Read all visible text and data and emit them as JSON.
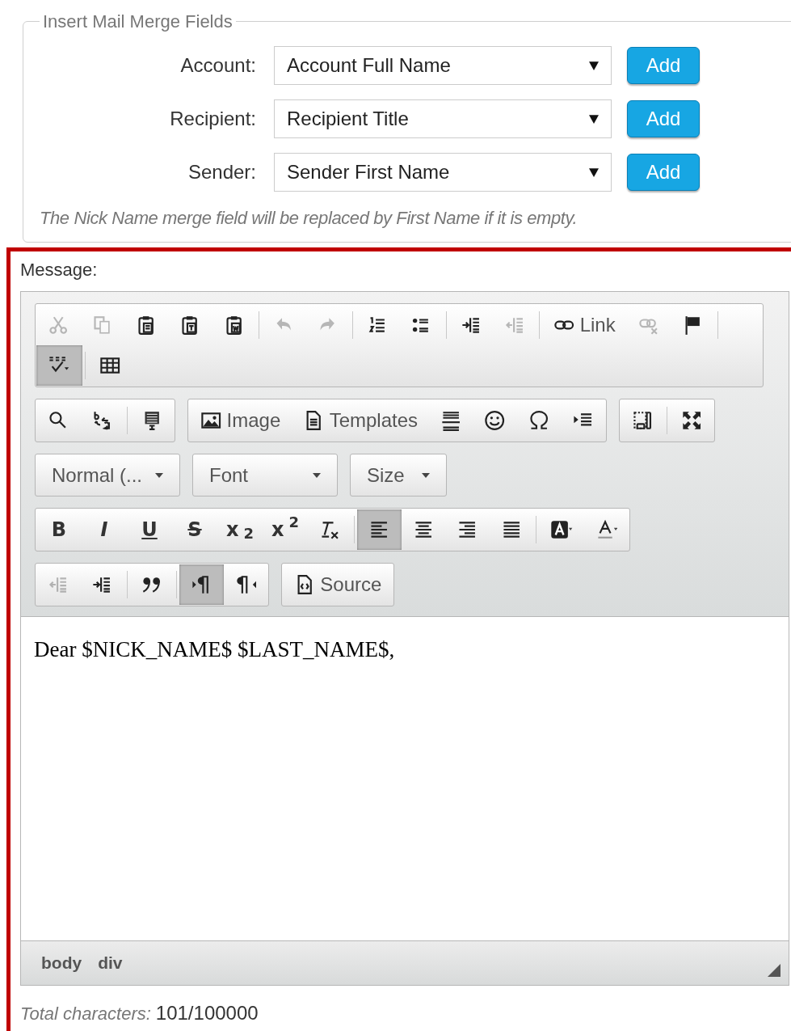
{
  "merge_fields": {
    "legend": "Insert Mail Merge Fields",
    "rows": [
      {
        "label": "Account:",
        "value": "Account Full Name",
        "button": "Add"
      },
      {
        "label": "Recipient:",
        "value": "Recipient Title",
        "button": "Add"
      },
      {
        "label": "Sender:",
        "value": "Sender First Name",
        "button": "Add"
      }
    ],
    "note": "The Nick Name merge field will be replaced by First Name if it is empty."
  },
  "message": {
    "label": "Message:",
    "toolbar": [
      {
        "groups": [
          {
            "lines": [
              [
                [
                  {
                    "kind": "cut",
                    "disabled": true,
                    "selected": false
                  },
                  {
                    "kind": "copy",
                    "disabled": true,
                    "selected": false
                  },
                  {
                    "kind": "paste",
                    "disabled": false,
                    "selected": false
                  },
                  {
                    "kind": "paste-text",
                    "disabled": false,
                    "selected": false
                  },
                  {
                    "kind": "paste-word",
                    "disabled": false,
                    "selected": false
                  }
                ],
                [
                  {
                    "kind": "undo",
                    "disabled": true,
                    "selected": false
                  },
                  {
                    "kind": "redo",
                    "disabled": true,
                    "selected": false
                  }
                ],
                [
                  {
                    "kind": "numbered-list",
                    "disabled": false,
                    "selected": false
                  },
                  {
                    "kind": "bulleted-list",
                    "disabled": false,
                    "selected": false
                  }
                ],
                [
                  {
                    "kind": "indent",
                    "disabled": false,
                    "selected": false
                  },
                  {
                    "kind": "outdent",
                    "disabled": true,
                    "selected": false
                  }
                ],
                [
                  {
                    "kind": "link",
                    "label": "Link",
                    "disabled": false,
                    "selected": false
                  },
                  {
                    "kind": "unlink",
                    "disabled": true,
                    "selected": false
                  },
                  {
                    "kind": "anchor",
                    "disabled": false,
                    "selected": false
                  }
                ]
              ],
              [
                [
                  {
                    "kind": "spellcheck",
                    "disabled": false,
                    "selected": true
                  }
                ],
                [
                  {
                    "kind": "table",
                    "disabled": false,
                    "selected": false
                  }
                ]
              ]
            ]
          }
        ]
      },
      {
        "groups": [
          {
            "sections": [
              [
                {
                  "kind": "find",
                  "disabled": false,
                  "selected": false
                },
                {
                  "kind": "replace",
                  "disabled": false,
                  "selected": false
                }
              ],
              [
                {
                  "kind": "select-all",
                  "disabled": false,
                  "selected": false
                }
              ]
            ]
          },
          {
            "sections": [
              [
                {
                  "kind": "image",
                  "label": "Image",
                  "disabled": false,
                  "selected": false
                },
                {
                  "kind": "templates",
                  "label": "Templates",
                  "disabled": false,
                  "selected": false
                },
                {
                  "kind": "horizontal-line",
                  "disabled": false,
                  "selected": false
                },
                {
                  "kind": "smiley",
                  "disabled": false,
                  "selected": false
                },
                {
                  "kind": "omega",
                  "disabled": false,
                  "selected": false
                },
                {
                  "kind": "page-break",
                  "disabled": false,
                  "selected": false
                }
              ]
            ]
          },
          {
            "sections": [
              [
                {
                  "kind": "show-blocks",
                  "disabled": false,
                  "selected": false
                }
              ],
              [
                {
                  "kind": "maximize",
                  "disabled": false,
                  "selected": false
                }
              ]
            ]
          }
        ]
      },
      {
        "combos": [
          {
            "label": "Normal (..."
          },
          {
            "label": "Font"
          },
          {
            "label": "Size"
          }
        ]
      },
      {
        "groups": [
          {
            "sections": [
              [
                {
                  "kind": "text",
                  "label": "B",
                  "disabled": false,
                  "selected": false
                },
                {
                  "kind": "text",
                  "label": "I",
                  "disabled": false,
                  "selected": false
                },
                {
                  "kind": "text",
                  "label": "U",
                  "disabled": false,
                  "selected": false
                },
                {
                  "kind": "text",
                  "label": "S",
                  "disabled": false,
                  "selected": false
                },
                {
                  "kind": "text",
                  "label": "x$_{2}$",
                  "disabled": false,
                  "selected": false
                },
                {
                  "kind": "text",
                  "label": "x$^{2}$",
                  "disabled": false,
                  "selected": false
                },
                {
                  "kind": "remove-format",
                  "disabled": false,
                  "selected": false
                }
              ],
              [
                {
                  "kind": "align-left",
                  "disabled": false,
                  "selected": true
                },
                {
                  "kind": "align-center",
                  "disabled": false,
                  "selected": false
                },
                {
                  "kind": "align-right",
                  "disabled": false,
                  "selected": false
                },
                {
                  "kind": "justify",
                  "disabled": false,
                  "selected": false
                }
              ],
              [
                {
                  "kind": "background-color",
                  "disabled": false,
                  "selected": false
                },
                {
                  "kind": "text-color",
                  "disabled": false,
                  "selected": false
                }
              ]
            ]
          }
        ]
      },
      {
        "groups": [
          {
            "sections": [
              [
                {
                  "kind": "outdent",
                  "disabled": true,
                  "selected": false
                },
                {
                  "kind": "indent",
                  "disabled": false,
                  "selected": false
                }
              ],
              [
                {
                  "kind": "blockquote",
                  "disabled": false,
                  "selected": false
                }
              ],
              [
                {
                  "kind": "ltr",
                  "disabled": false,
                  "selected": true
                },
                {
                  "kind": "rtl",
                  "disabled": false,
                  "selected": false
                }
              ]
            ]
          },
          {
            "sections": [
              [
                {
                  "kind": "source",
                  "label": "Source",
                  "disabled": false,
                  "selected": false
                }
              ]
            ]
          }
        ]
      }
    ],
    "content": "Dear $NICK_NAME$ $LAST_NAME$,",
    "path": [
      "body",
      "div"
    ],
    "count_label": "Total characters:",
    "count_value": "101/100000"
  }
}
